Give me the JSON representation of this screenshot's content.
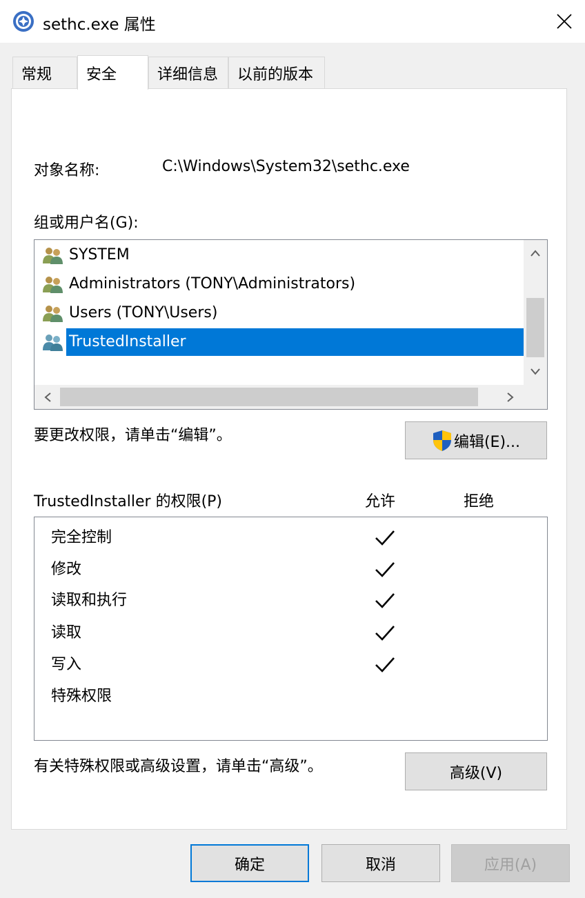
{
  "window": {
    "title": "sethc.exe 属性",
    "icon": "app-icon",
    "close_icon": "close-icon"
  },
  "tabs": [
    {
      "label": "常规",
      "active": false
    },
    {
      "label": "安全",
      "active": true
    },
    {
      "label": "详细信息",
      "active": false
    },
    {
      "label": "以前的版本",
      "active": false
    }
  ],
  "security": {
    "object_name_label": "对象名称:",
    "object_name_value": "C:\\Windows\\System32\\sethc.exe",
    "group_label": "组或用户名(G):",
    "users": [
      {
        "name": "SYSTEM",
        "icon": "user-group-icon",
        "selected": false
      },
      {
        "name": "Administrators (TONY\\Administrators)",
        "icon": "user-group-icon",
        "selected": false
      },
      {
        "name": "Users (TONY\\Users)",
        "icon": "user-group-icon",
        "selected": false
      },
      {
        "name": "TrustedInstaller",
        "icon": "user-group-icon",
        "selected": true
      }
    ],
    "edit_hint": "要更改权限，请单击“编辑”。",
    "edit_button": "编辑(E)...",
    "permissions_label": "TrustedInstaller 的权限(P)",
    "allow_header": "允许",
    "deny_header": "拒绝",
    "permissions": [
      {
        "name": "完全控制",
        "allow": true,
        "deny": false
      },
      {
        "name": "修改",
        "allow": true,
        "deny": false
      },
      {
        "name": "读取和执行",
        "allow": true,
        "deny": false
      },
      {
        "name": "读取",
        "allow": true,
        "deny": false
      },
      {
        "name": "写入",
        "allow": true,
        "deny": false
      },
      {
        "name": "特殊权限",
        "allow": false,
        "deny": false
      }
    ],
    "advanced_hint": "有关特殊权限或高级设置，请单击“高级”。",
    "advanced_button": "高级(V)"
  },
  "footer": {
    "ok_button": "确定",
    "cancel_button": "取消",
    "apply_button": "应用(A)"
  },
  "colors": {
    "selection": "#0078d7",
    "shield_blue": "#1f5fbf",
    "shield_yellow": "#ffc40c"
  }
}
